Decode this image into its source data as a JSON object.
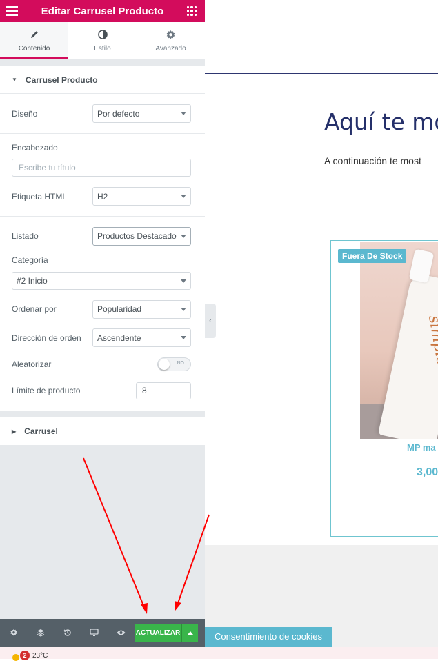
{
  "panel": {
    "title": "Editar Carrusel Producto",
    "tabs": [
      {
        "label": "Contenido",
        "icon": "pencil-icon",
        "active": true
      },
      {
        "label": "Estilo",
        "icon": "contrast-icon",
        "active": false
      },
      {
        "label": "Avanzado",
        "icon": "gear-icon",
        "active": false
      }
    ],
    "section1": {
      "title": "Carrusel Producto",
      "diseno_label": "Diseño",
      "diseno_value": "Por defecto",
      "encabezado_label": "Encabezado",
      "encabezado_placeholder": "Escribe tu título",
      "etiqueta_label": "Etiqueta HTML",
      "etiqueta_value": "H2",
      "listado_label": "Listado",
      "listado_value": "Productos Destacado",
      "categoria_label": "Categoría",
      "categoria_value": "#2 Inicio",
      "ordenar_label": "Ordenar por",
      "ordenar_value": "Popularidad",
      "direccion_label": "Dirección de orden",
      "direccion_value": "Ascendente",
      "aleatorizar_label": "Aleatorizar",
      "aleatorizar_toggle": "NO",
      "limite_label": "Límite de producto",
      "limite_value": "8"
    },
    "section2": {
      "title": "Carrusel"
    },
    "footer": {
      "update_label": "ACTUALIZAR"
    }
  },
  "preview": {
    "heading": "Aquí te mo",
    "subtitle": "A continuación te most",
    "card": {
      "badge": "Fuera De Stock",
      "product_name": "MP ma",
      "price": "3,00",
      "bottle_script": "simple"
    },
    "cookie_button": "Consentimiento de cookies"
  },
  "taskbar": {
    "notification_count": "2",
    "temperature": "23°C"
  },
  "colors": {
    "brand": "#d30c5c",
    "update_green": "#39b54a",
    "accent_teal": "#5bb8cf",
    "heading_navy": "#25306a",
    "annotation_red": "#ff0000"
  }
}
